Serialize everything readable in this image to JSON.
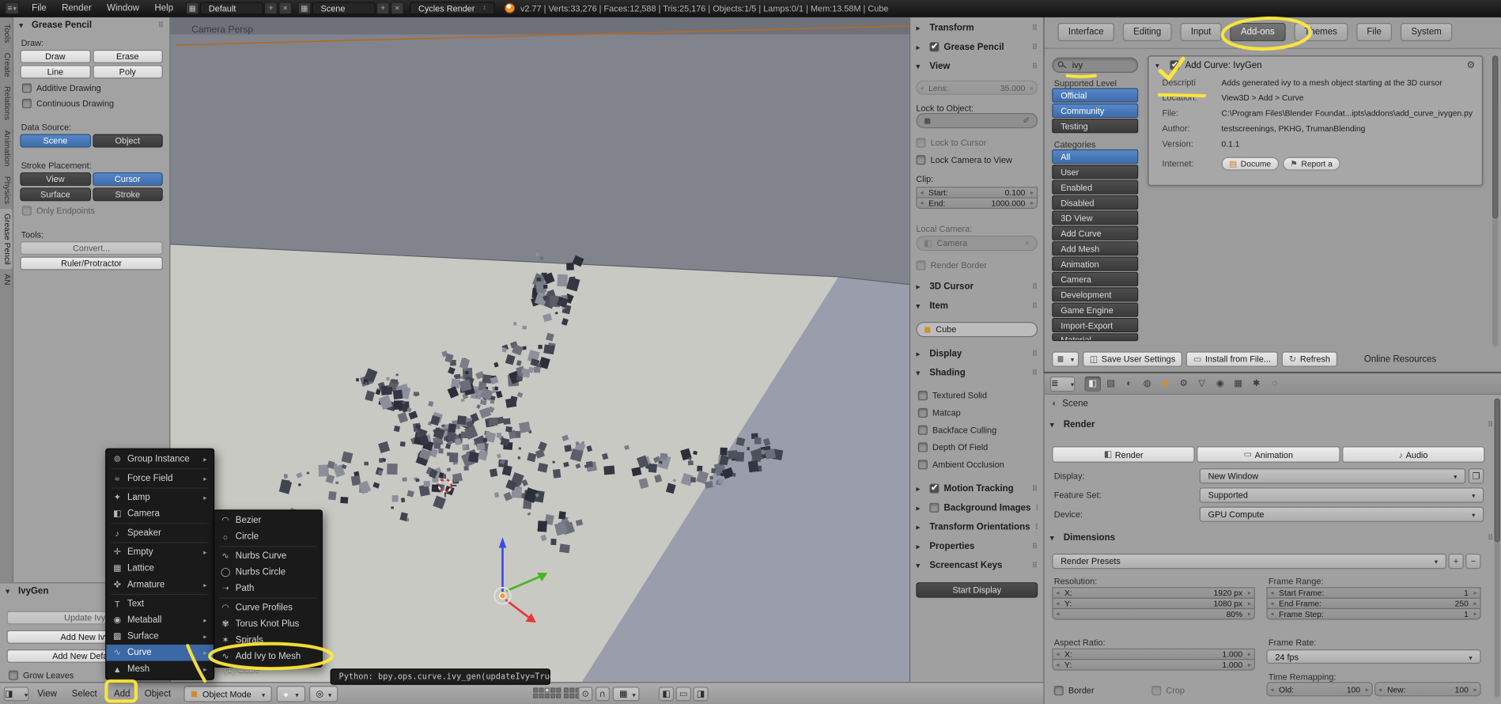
{
  "topbar": {
    "menus": [
      "File",
      "Render",
      "Window",
      "Help"
    ],
    "layout": "Default",
    "scene": "Scene",
    "engine": "Cycles Render",
    "stats": "v2.77 | Verts:33,276 | Faces:12,588 | Tris:25,176 | Objects:1/5 | Lamps:0/1 | Mem:13.58M | Cube"
  },
  "left_tabs": [
    {
      "label": "Tools",
      "name": "toolshelf-tab-tools"
    },
    {
      "label": "Create",
      "name": "toolshelf-tab-create"
    },
    {
      "label": "Relations",
      "name": "toolshelf-tab-relations"
    },
    {
      "label": "Animation",
      "name": "toolshelf-tab-animation"
    },
    {
      "label": "Physics",
      "name": "toolshelf-tab-physics"
    },
    {
      "label": "Grease Pencil",
      "cls": "active",
      "name": "toolshelf-tab-grease-pencil"
    },
    {
      "label": "AN",
      "name": "toolshelf-tab-an"
    }
  ],
  "tool_shelf": {
    "panel_title": "Grease Pencil",
    "draw_label": "Draw:",
    "draw": "Draw",
    "erase": "Erase",
    "line": "Line",
    "poly": "Poly",
    "additive": "Additive Drawing",
    "continuous": "Continuous Drawing",
    "data_source_label": "Data Source:",
    "scene": "Scene",
    "object": "Object",
    "stroke_placement_label": "Stroke Placement:",
    "view": "View",
    "cursor": "Cursor",
    "surface": "Surface",
    "stroke": "Stroke",
    "only_endpoints": "Only Endpoints",
    "tools_label": "Tools:",
    "convert": "Convert...",
    "ruler": "Ruler/Protractor"
  },
  "ivygen": {
    "title": "IvyGen",
    "update": "Update Ivy",
    "add_new": "Add New Ivy",
    "add_default": "Add New Default",
    "grow_leaves": "Grow Leaves"
  },
  "viewport": {
    "label": "Camera Persp",
    "object_info": "(1) Cube"
  },
  "add_menu": {
    "items": [
      {
        "label": "Group Instance",
        "icon": "⊚",
        "cls": "sub sep",
        "name": "add-menu-item-group-instance"
      },
      {
        "label": "Force Field",
        "icon": "≈",
        "cls": "sub sep",
        "name": "add-menu-item-force-field"
      },
      {
        "label": "Lamp",
        "icon": "✦",
        "cls": "sub",
        "name": "add-menu-item-lamp"
      },
      {
        "label": "Camera",
        "icon": "◧",
        "cls": "sep",
        "name": "add-menu-item-camera"
      },
      {
        "label": "Speaker",
        "icon": "♪",
        "cls": "sep",
        "name": "add-menu-item-speaker"
      },
      {
        "label": "Empty",
        "icon": "✛",
        "cls": "sub",
        "name": "add-menu-item-empty"
      },
      {
        "label": "Lattice",
        "icon": "▦",
        "name": "add-menu-item-lattice"
      },
      {
        "label": "Armature",
        "icon": "✜",
        "cls": "sub sep",
        "name": "add-menu-item-armature"
      },
      {
        "label": "Text",
        "icon": "T",
        "name": "add-menu-item-text"
      },
      {
        "label": "Metaball",
        "icon": "◉",
        "cls": "sub",
        "name": "add-menu-item-metaball"
      },
      {
        "label": "Surface",
        "icon": "▩",
        "cls": "sub",
        "name": "add-menu-item-surface"
      },
      {
        "label": "Curve",
        "icon": "∿",
        "cls": "sub hl",
        "name": "add-menu-item-curve"
      },
      {
        "label": "Mesh",
        "icon": "▲",
        "cls": "sub",
        "name": "add-menu-item-mesh"
      }
    ]
  },
  "curve_menu": {
    "items": [
      {
        "label": "Bezier",
        "icon": "◠",
        "name": "curve-menu-item-bezier"
      },
      {
        "label": "Circle",
        "icon": "○",
        "cls": "sep",
        "name": "curve-menu-item-circle"
      },
      {
        "label": "Nurbs Curve",
        "icon": "∿",
        "name": "curve-menu-item-nurbs-curve"
      },
      {
        "label": "Nurbs Circle",
        "icon": "◯",
        "name": "curve-menu-item-nurbs-circle"
      },
      {
        "label": "Path",
        "icon": "➝",
        "cls": "sep",
        "name": "curve-menu-item-path"
      },
      {
        "label": "Curve Profiles",
        "icon": "◠",
        "name": "curve-menu-item-curve-profiles"
      },
      {
        "label": "Torus Knot Plus",
        "icon": "✾",
        "name": "curve-menu-item-torus-knot-plus"
      },
      {
        "label": "Spirals",
        "icon": "✶",
        "name": "curve-menu-item-spirals"
      },
      {
        "label": "Add Ivy to Mesh",
        "icon": "∿",
        "name": "curve-menu-item-add-ivy-to-mesh"
      }
    ]
  },
  "bottom_bar": {
    "menus": [
      {
        "label": "View"
      },
      {
        "label": "Select"
      },
      {
        "label": "Add"
      },
      {
        "label": "Object"
      }
    ],
    "mode": "Object Mode",
    "tooltip": "Python: bpy.ops.curve.ivy_gen(updateIvy=True)"
  },
  "npanel": {
    "transform": "Transform",
    "grease_pencil": "Grease Pencil",
    "view": "View",
    "lens": {
      "k": "Lens:",
      "v": "35.000"
    },
    "lock_to_object": "Lock to Object:",
    "lock_to_cursor": "Lock to Cursor",
    "lock_camera": "Lock Camera to View",
    "clip": "Clip:",
    "clip_fields": [
      {
        "k": "Start:",
        "v": "0.100"
      },
      {
        "k": "End:",
        "v": "1000.000"
      }
    ],
    "local_camera_label": "Local Camera:",
    "local_camera_value": "Camera",
    "render_border": "Render Border",
    "cursor_3d": "3D Cursor",
    "item": "Item",
    "item_value": "Cube",
    "display": "Display",
    "shading": "Shading",
    "shading_opts": [
      {
        "label": "Textured Solid",
        "name": "row-textured-solid"
      },
      {
        "label": "Matcap",
        "name": "row-matcap"
      },
      {
        "label": "Backface Culling",
        "name": "row-backface-culling"
      },
      {
        "label": "Depth Of Field",
        "name": "row-depth-of-field"
      },
      {
        "label": "Ambient Occlusion",
        "name": "row-ambient-occlusion"
      }
    ],
    "motion_tracking": "Motion Tracking",
    "background_images": "Background Images",
    "transform_orientations": "Transform Orientations",
    "properties": "Properties",
    "screencast_keys": "Screencast Keys",
    "start_display": "Start Display"
  },
  "prefs": {
    "tabs": [
      {
        "label": "Interface",
        "name": "prefs-tab-interface"
      },
      {
        "label": "Editing",
        "name": "prefs-tab-editing"
      },
      {
        "label": "Input",
        "name": "prefs-tab-input"
      },
      {
        "label": "Add-ons",
        "cls": "active",
        "name": "prefs-tab-addons"
      },
      {
        "label": "Themes",
        "name": "prefs-tab-themes"
      },
      {
        "label": "File",
        "name": "prefs-tab-file"
      },
      {
        "label": "System",
        "name": "prefs-tab-system"
      }
    ],
    "search": "ivy",
    "supported_level": "Supported Level",
    "levels": [
      {
        "label": "Official",
        "cls": "blue",
        "name": "level-official"
      },
      {
        "label": "Community",
        "cls": "blue",
        "name": "level-community"
      },
      {
        "label": "Testing",
        "cls": "darkb",
        "name": "level-testing"
      }
    ],
    "categories_label": "Categories",
    "categories": [
      {
        "label": "All",
        "cls": "blue",
        "name": "category-all"
      },
      {
        "label": "User",
        "cls": "darkb",
        "name": "category-user"
      },
      {
        "label": "Enabled",
        "cls": "darkb",
        "name": "category-enabled"
      },
      {
        "label": "Disabled",
        "cls": "darkb",
        "name": "category-disabled"
      },
      {
        "label": "3D View",
        "cls": "darkb",
        "name": "category-3d-view"
      },
      {
        "label": "Add Curve",
        "cls": "darkb",
        "name": "category-add-curve"
      },
      {
        "label": "Add Mesh",
        "cls": "darkb",
        "name": "category-add-mesh"
      },
      {
        "label": "Animation",
        "cls": "darkb",
        "name": "category-animation"
      },
      {
        "label": "Camera",
        "cls": "darkb",
        "name": "category-camera"
      },
      {
        "label": "Development",
        "cls": "darkb",
        "name": "category-development"
      },
      {
        "label": "Game Engine",
        "cls": "darkb",
        "name": "category-game-engine"
      },
      {
        "label": "Import-Export",
        "cls": "darkb",
        "name": "category-import-export"
      },
      {
        "label": "Material",
        "cls": "darkb clip",
        "name": "category-material"
      }
    ],
    "addon": {
      "title": "Add Curve: IvyGen",
      "rows": [
        {
          "label": "Descripti",
          "value": "Adds generated ivy to a mesh object starting at the 3D cursor"
        },
        {
          "label": "Location:",
          "value": "View3D > Add > Curve"
        },
        {
          "label": "File:",
          "value": "C:\\Program Files\\Blender Foundat...ipts\\addons\\add_curve_ivygen.py"
        },
        {
          "label": "Author:",
          "value": "testscreenings, PKHG, TrumanBlending"
        },
        {
          "label": "Version:",
          "value": "0.1.1"
        }
      ],
      "internet_label": "Internet:",
      "doc_btn": "Docume",
      "report_btn": "Report a"
    },
    "footer": {
      "save": "Save User Settings",
      "install": "Install from File...",
      "refresh": "Refresh",
      "online": "Online Resources"
    }
  },
  "props": {
    "breadcrumb": "Scene",
    "render_header": "Render",
    "tabs": [
      {
        "icon": "◧",
        "cls": "active",
        "name": "properties-tab-render"
      },
      {
        "icon": "▧",
        "name": "properties-tab-render-layers"
      },
      {
        "icon": "◐",
        "name": "properties-tab-scene"
      },
      {
        "icon": "◍",
        "name": "properties-tab-world"
      },
      {
        "icon": "◆",
        "cls": "orange",
        "name": "properties-tab-object"
      },
      {
        "icon": "⚙",
        "name": "properties-tab-modifiers"
      },
      {
        "icon": "▽",
        "name": "properties-tab-data"
      },
      {
        "icon": "◉",
        "name": "properties-tab-material"
      },
      {
        "icon": "▦",
        "name": "properties-tab-texture"
      },
      {
        "icon": "✱",
        "name": "properties-tab-particles"
      },
      {
        "icon": "◌",
        "name": "properties-tab-physics"
      }
    ],
    "render_btn": "Render",
    "animation_btn": "Animation",
    "audio_btn": "Audio",
    "display_label": "Display:",
    "display_value": "New Window",
    "feature_label": "Feature Set:",
    "feature_value": "Supported",
    "device_label": "Device:",
    "device_value": "GPU Compute",
    "dimensions_header": "Dimensions",
    "render_presets": "Render Presets",
    "resolution_label": "Resolution:",
    "res_fields": [
      {
        "k": "X:",
        "v": "1920 px"
      },
      {
        "k": "Y:",
        "v": "1080 px"
      },
      {
        "k": "",
        "v": "80%"
      }
    ],
    "aspect_label": "Aspect Ratio:",
    "aspect_fields": [
      {
        "k": "X:",
        "v": "1.000"
      },
      {
        "k": "Y:",
        "v": "1.000"
      }
    ],
    "border": "Border",
    "crop": "Crop",
    "frame_range_label": "Frame Range:",
    "frame_fields": [
      {
        "k": "Start Frame:",
        "v": "1"
      },
      {
        "k": "End Frame:",
        "v": "250"
      },
      {
        "k": "Frame Step:",
        "v": "1"
      }
    ],
    "frame_rate_label": "Frame Rate:",
    "fps": "24 fps",
    "time_remap_label": "Time Remapping:",
    "remap_fields": [
      {
        "k": "Old:",
        "v": "100"
      },
      {
        "k": "New:",
        "v": "100"
      }
    ]
  },
  "icons": {
    "info_editor": "≡",
    "browse": "▦",
    "plus": "+",
    "close": "×",
    "updown": "↕",
    "minus": "−",
    "view3d_editor": "◨",
    "mode_cube": "◼",
    "shading": "●",
    "pivot": "◎",
    "lock": "⊙",
    "magnet": "∪",
    "render1": "◧",
    "render2": "▭",
    "render3": "◨",
    "wrench": "⚙",
    "doc": "▤",
    "bug": "⚑",
    "menu_list": "≣",
    "save": "◫",
    "folder": "▭",
    "refresh": "↻",
    "scene": "◐",
    "camera": "◧",
    "eyedropper": "✐",
    "cube": "◼",
    "window": "❐",
    "render_btn": "◧",
    "animation_btn": "▭",
    "audio_btn": "♪"
  }
}
